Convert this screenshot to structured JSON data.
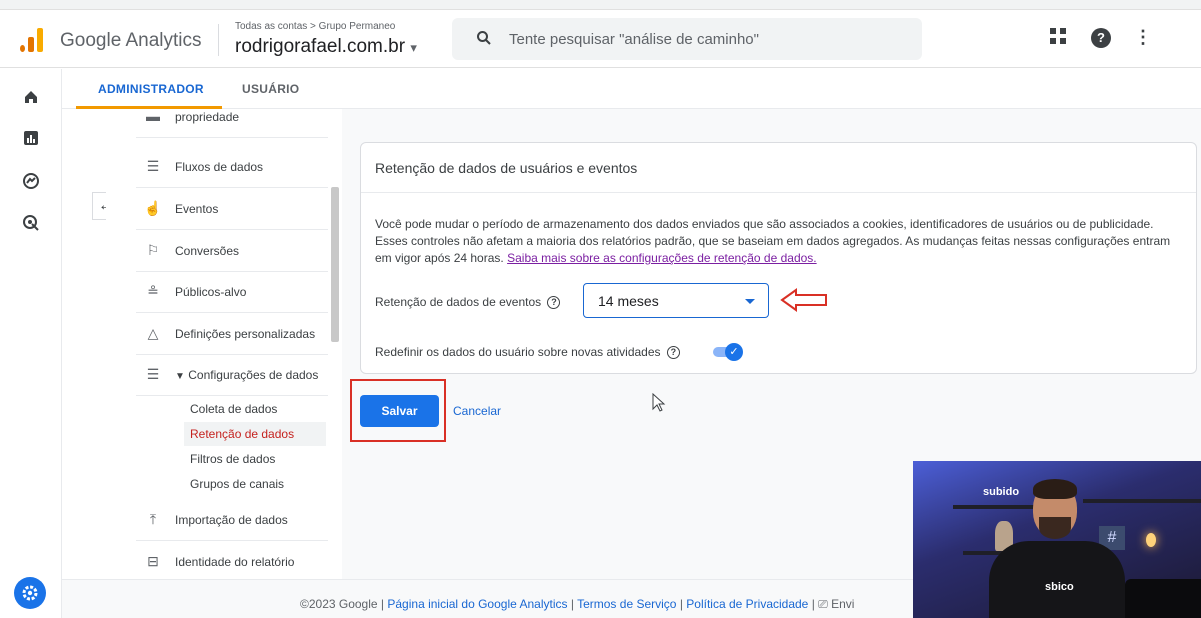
{
  "header": {
    "brand": "Google Analytics",
    "breadcrumb": "Todas as contas > Grupo Permaneo",
    "property": "rodrigorafael.com.br",
    "property_caret": "▾",
    "search_placeholder": "Tente pesquisar \"análise de caminho\""
  },
  "tabs": {
    "admin": "ADMINISTRADOR",
    "user": "USUÁRIO"
  },
  "admin_nav": {
    "items": [
      {
        "label": "propriedade",
        "icon": "property-icon"
      },
      {
        "label": "Fluxos de dados",
        "icon": "data-streams-icon"
      },
      {
        "label": "Eventos",
        "icon": "events-icon"
      },
      {
        "label": "Conversões",
        "icon": "flag-icon"
      },
      {
        "label": "Públicos-alvo",
        "icon": "audiences-icon"
      },
      {
        "label": "Definições personalizadas",
        "icon": "shapes-icon"
      },
      {
        "label": "Configurações de dados",
        "icon": "database-icon"
      },
      {
        "label": "Importação de dados",
        "icon": "upload-icon"
      },
      {
        "label": "Identidade do relatório",
        "icon": "report-identity-icon"
      }
    ],
    "subitems": [
      {
        "label": "Coleta de dados"
      },
      {
        "label": "Retenção de dados"
      },
      {
        "label": "Filtros de dados"
      },
      {
        "label": "Grupos de canais"
      }
    ]
  },
  "card": {
    "title": "Retenção de dados de usuários e eventos",
    "description": "Você pode mudar o período de armazenamento dos dados enviados que são associados a cookies, identificadores de usuários ou de publicidade. Esses controles não afetam a maioria dos relatórios padrão, que se baseiam em dados agregados. As mudanças feitas nessas configurações entram em vigor após 24 horas.",
    "learn_more": "Saiba mais sobre as configurações de retenção de dados.",
    "event_retention_label": "Retenção de dados de eventos",
    "event_retention_value": "14 meses",
    "reset_label": "Redefinir os dados do usuário sobre novas atividades",
    "reset_enabled": true
  },
  "actions": {
    "save": "Salvar",
    "cancel": "Cancelar"
  },
  "footer": {
    "copyright": "©2023 Google |",
    "home_link": "Página inicial do Google Analytics",
    "sep1": "|",
    "terms_link": "Termos de Serviço",
    "sep2": "|",
    "privacy_link": "Política de Privacidade",
    "sep3": "|",
    "feedback": "Envi"
  },
  "webcam": {
    "sign_text": "subido",
    "shirt_text": "sbico",
    "hash": "#"
  },
  "colors": {
    "accent": "#1a73e8",
    "highlight": "#d93025",
    "tab_underline": "#f29900"
  }
}
